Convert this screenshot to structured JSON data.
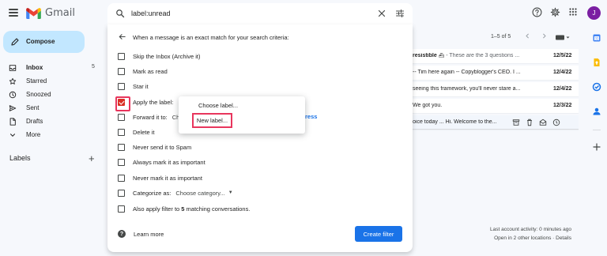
{
  "app": {
    "name": "Gmail"
  },
  "search": {
    "query": "label:unread"
  },
  "header": {
    "avatar_initial": "J"
  },
  "compose": {
    "label": "Compose"
  },
  "sidebar": {
    "items": [
      {
        "label": "Inbox",
        "count": "5"
      },
      {
        "label": "Starred"
      },
      {
        "label": "Snoozed"
      },
      {
        "label": "Sent"
      },
      {
        "label": "Drafts"
      },
      {
        "label": "More"
      }
    ],
    "labels_heading": "Labels"
  },
  "mail_list": {
    "pager": "1–5 of 5",
    "rows": [
      {
        "bold": "resistible",
        "snippet": " - These are the 3 questions ...",
        "date": "12/5/22"
      },
      {
        "bold": "",
        "snippet": "-- Tim here again -- Copyblogger's CEO. I ...",
        "date": "12/4/22"
      },
      {
        "bold": "",
        "snippet": "seeing this framework, you'll never stare a...",
        "date": "12/4/22"
      },
      {
        "bold": "",
        "snippet": "We got you.",
        "date": "12/3/22"
      },
      {
        "bold": "",
        "snippet": "oice today ... Hi. Welcome to the...",
        "date": ""
      }
    ],
    "activity": [
      "Last account activity: 0 minutes ago",
      "Open in 2 other locations · Details"
    ]
  },
  "filter": {
    "heading": "When a message is an exact match for your search criteria:",
    "options": [
      {
        "label": "Skip the Inbox (Archive it)",
        "checked": false
      },
      {
        "label": "Mark as read",
        "checked": false
      },
      {
        "label": "Star it",
        "checked": false
      },
      {
        "label": "Apply the label:",
        "checked": true
      },
      {
        "label": "Forward it to:",
        "trail": "Ch",
        "checked": false
      },
      {
        "label": "Delete it",
        "checked": false
      },
      {
        "label": "Never send it to Spam",
        "checked": false
      },
      {
        "label": "Always mark it as important",
        "checked": false
      },
      {
        "label": "Never mark it as important",
        "checked": false
      },
      {
        "label": "Categorize as:",
        "dropdown": "Choose category...",
        "checked": false
      },
      {
        "label_pre": "Also apply filter to ",
        "label_bold": "5",
        "label_post": " matching conversations.",
        "checked": false
      }
    ],
    "forward_tail": "ress",
    "learn_more": "Learn more",
    "create_button": "Create filter"
  },
  "label_menu": {
    "items": [
      "Choose label...",
      "New label..."
    ]
  },
  "colors": {
    "primary": "#1a73e8",
    "checkbox_checked": "#d93025",
    "highlight": "#e8365d",
    "compose_bg": "#c2e7ff"
  }
}
